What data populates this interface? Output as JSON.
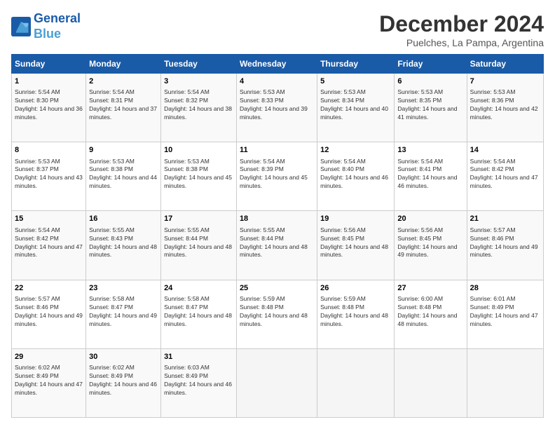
{
  "header": {
    "logo_line1": "General",
    "logo_line2": "Blue",
    "title": "December 2024",
    "subtitle": "Puelches, La Pampa, Argentina"
  },
  "days_of_week": [
    "Sunday",
    "Monday",
    "Tuesday",
    "Wednesday",
    "Thursday",
    "Friday",
    "Saturday"
  ],
  "weeks": [
    [
      {
        "day": "1",
        "sunrise": "5:54 AM",
        "sunset": "8:30 PM",
        "daylight": "14 hours and 36 minutes."
      },
      {
        "day": "2",
        "sunrise": "5:54 AM",
        "sunset": "8:31 PM",
        "daylight": "14 hours and 37 minutes."
      },
      {
        "day": "3",
        "sunrise": "5:54 AM",
        "sunset": "8:32 PM",
        "daylight": "14 hours and 38 minutes."
      },
      {
        "day": "4",
        "sunrise": "5:53 AM",
        "sunset": "8:33 PM",
        "daylight": "14 hours and 39 minutes."
      },
      {
        "day": "5",
        "sunrise": "5:53 AM",
        "sunset": "8:34 PM",
        "daylight": "14 hours and 40 minutes."
      },
      {
        "day": "6",
        "sunrise": "5:53 AM",
        "sunset": "8:35 PM",
        "daylight": "14 hours and 41 minutes."
      },
      {
        "day": "7",
        "sunrise": "5:53 AM",
        "sunset": "8:36 PM",
        "daylight": "14 hours and 42 minutes."
      }
    ],
    [
      {
        "day": "8",
        "sunrise": "5:53 AM",
        "sunset": "8:37 PM",
        "daylight": "14 hours and 43 minutes."
      },
      {
        "day": "9",
        "sunrise": "5:53 AM",
        "sunset": "8:38 PM",
        "daylight": "14 hours and 44 minutes."
      },
      {
        "day": "10",
        "sunrise": "5:53 AM",
        "sunset": "8:38 PM",
        "daylight": "14 hours and 45 minutes."
      },
      {
        "day": "11",
        "sunrise": "5:54 AM",
        "sunset": "8:39 PM",
        "daylight": "14 hours and 45 minutes."
      },
      {
        "day": "12",
        "sunrise": "5:54 AM",
        "sunset": "8:40 PM",
        "daylight": "14 hours and 46 minutes."
      },
      {
        "day": "13",
        "sunrise": "5:54 AM",
        "sunset": "8:41 PM",
        "daylight": "14 hours and 46 minutes."
      },
      {
        "day": "14",
        "sunrise": "5:54 AM",
        "sunset": "8:42 PM",
        "daylight": "14 hours and 47 minutes."
      }
    ],
    [
      {
        "day": "15",
        "sunrise": "5:54 AM",
        "sunset": "8:42 PM",
        "daylight": "14 hours and 47 minutes."
      },
      {
        "day": "16",
        "sunrise": "5:55 AM",
        "sunset": "8:43 PM",
        "daylight": "14 hours and 48 minutes."
      },
      {
        "day": "17",
        "sunrise": "5:55 AM",
        "sunset": "8:44 PM",
        "daylight": "14 hours and 48 minutes."
      },
      {
        "day": "18",
        "sunrise": "5:55 AM",
        "sunset": "8:44 PM",
        "daylight": "14 hours and 48 minutes."
      },
      {
        "day": "19",
        "sunrise": "5:56 AM",
        "sunset": "8:45 PM",
        "daylight": "14 hours and 48 minutes."
      },
      {
        "day": "20",
        "sunrise": "5:56 AM",
        "sunset": "8:45 PM",
        "daylight": "14 hours and 49 minutes."
      },
      {
        "day": "21",
        "sunrise": "5:57 AM",
        "sunset": "8:46 PM",
        "daylight": "14 hours and 49 minutes."
      }
    ],
    [
      {
        "day": "22",
        "sunrise": "5:57 AM",
        "sunset": "8:46 PM",
        "daylight": "14 hours and 49 minutes."
      },
      {
        "day": "23",
        "sunrise": "5:58 AM",
        "sunset": "8:47 PM",
        "daylight": "14 hours and 49 minutes."
      },
      {
        "day": "24",
        "sunrise": "5:58 AM",
        "sunset": "8:47 PM",
        "daylight": "14 hours and 48 minutes."
      },
      {
        "day": "25",
        "sunrise": "5:59 AM",
        "sunset": "8:48 PM",
        "daylight": "14 hours and 48 minutes."
      },
      {
        "day": "26",
        "sunrise": "5:59 AM",
        "sunset": "8:48 PM",
        "daylight": "14 hours and 48 minutes."
      },
      {
        "day": "27",
        "sunrise": "6:00 AM",
        "sunset": "8:48 PM",
        "daylight": "14 hours and 48 minutes."
      },
      {
        "day": "28",
        "sunrise": "6:01 AM",
        "sunset": "8:49 PM",
        "daylight": "14 hours and 47 minutes."
      }
    ],
    [
      {
        "day": "29",
        "sunrise": "6:02 AM",
        "sunset": "8:49 PM",
        "daylight": "14 hours and 47 minutes."
      },
      {
        "day": "30",
        "sunrise": "6:02 AM",
        "sunset": "8:49 PM",
        "daylight": "14 hours and 46 minutes."
      },
      {
        "day": "31",
        "sunrise": "6:03 AM",
        "sunset": "8:49 PM",
        "daylight": "14 hours and 46 minutes."
      },
      null,
      null,
      null,
      null
    ]
  ],
  "labels": {
    "sunrise": "Sunrise:",
    "sunset": "Sunset:",
    "daylight": "Daylight:"
  }
}
